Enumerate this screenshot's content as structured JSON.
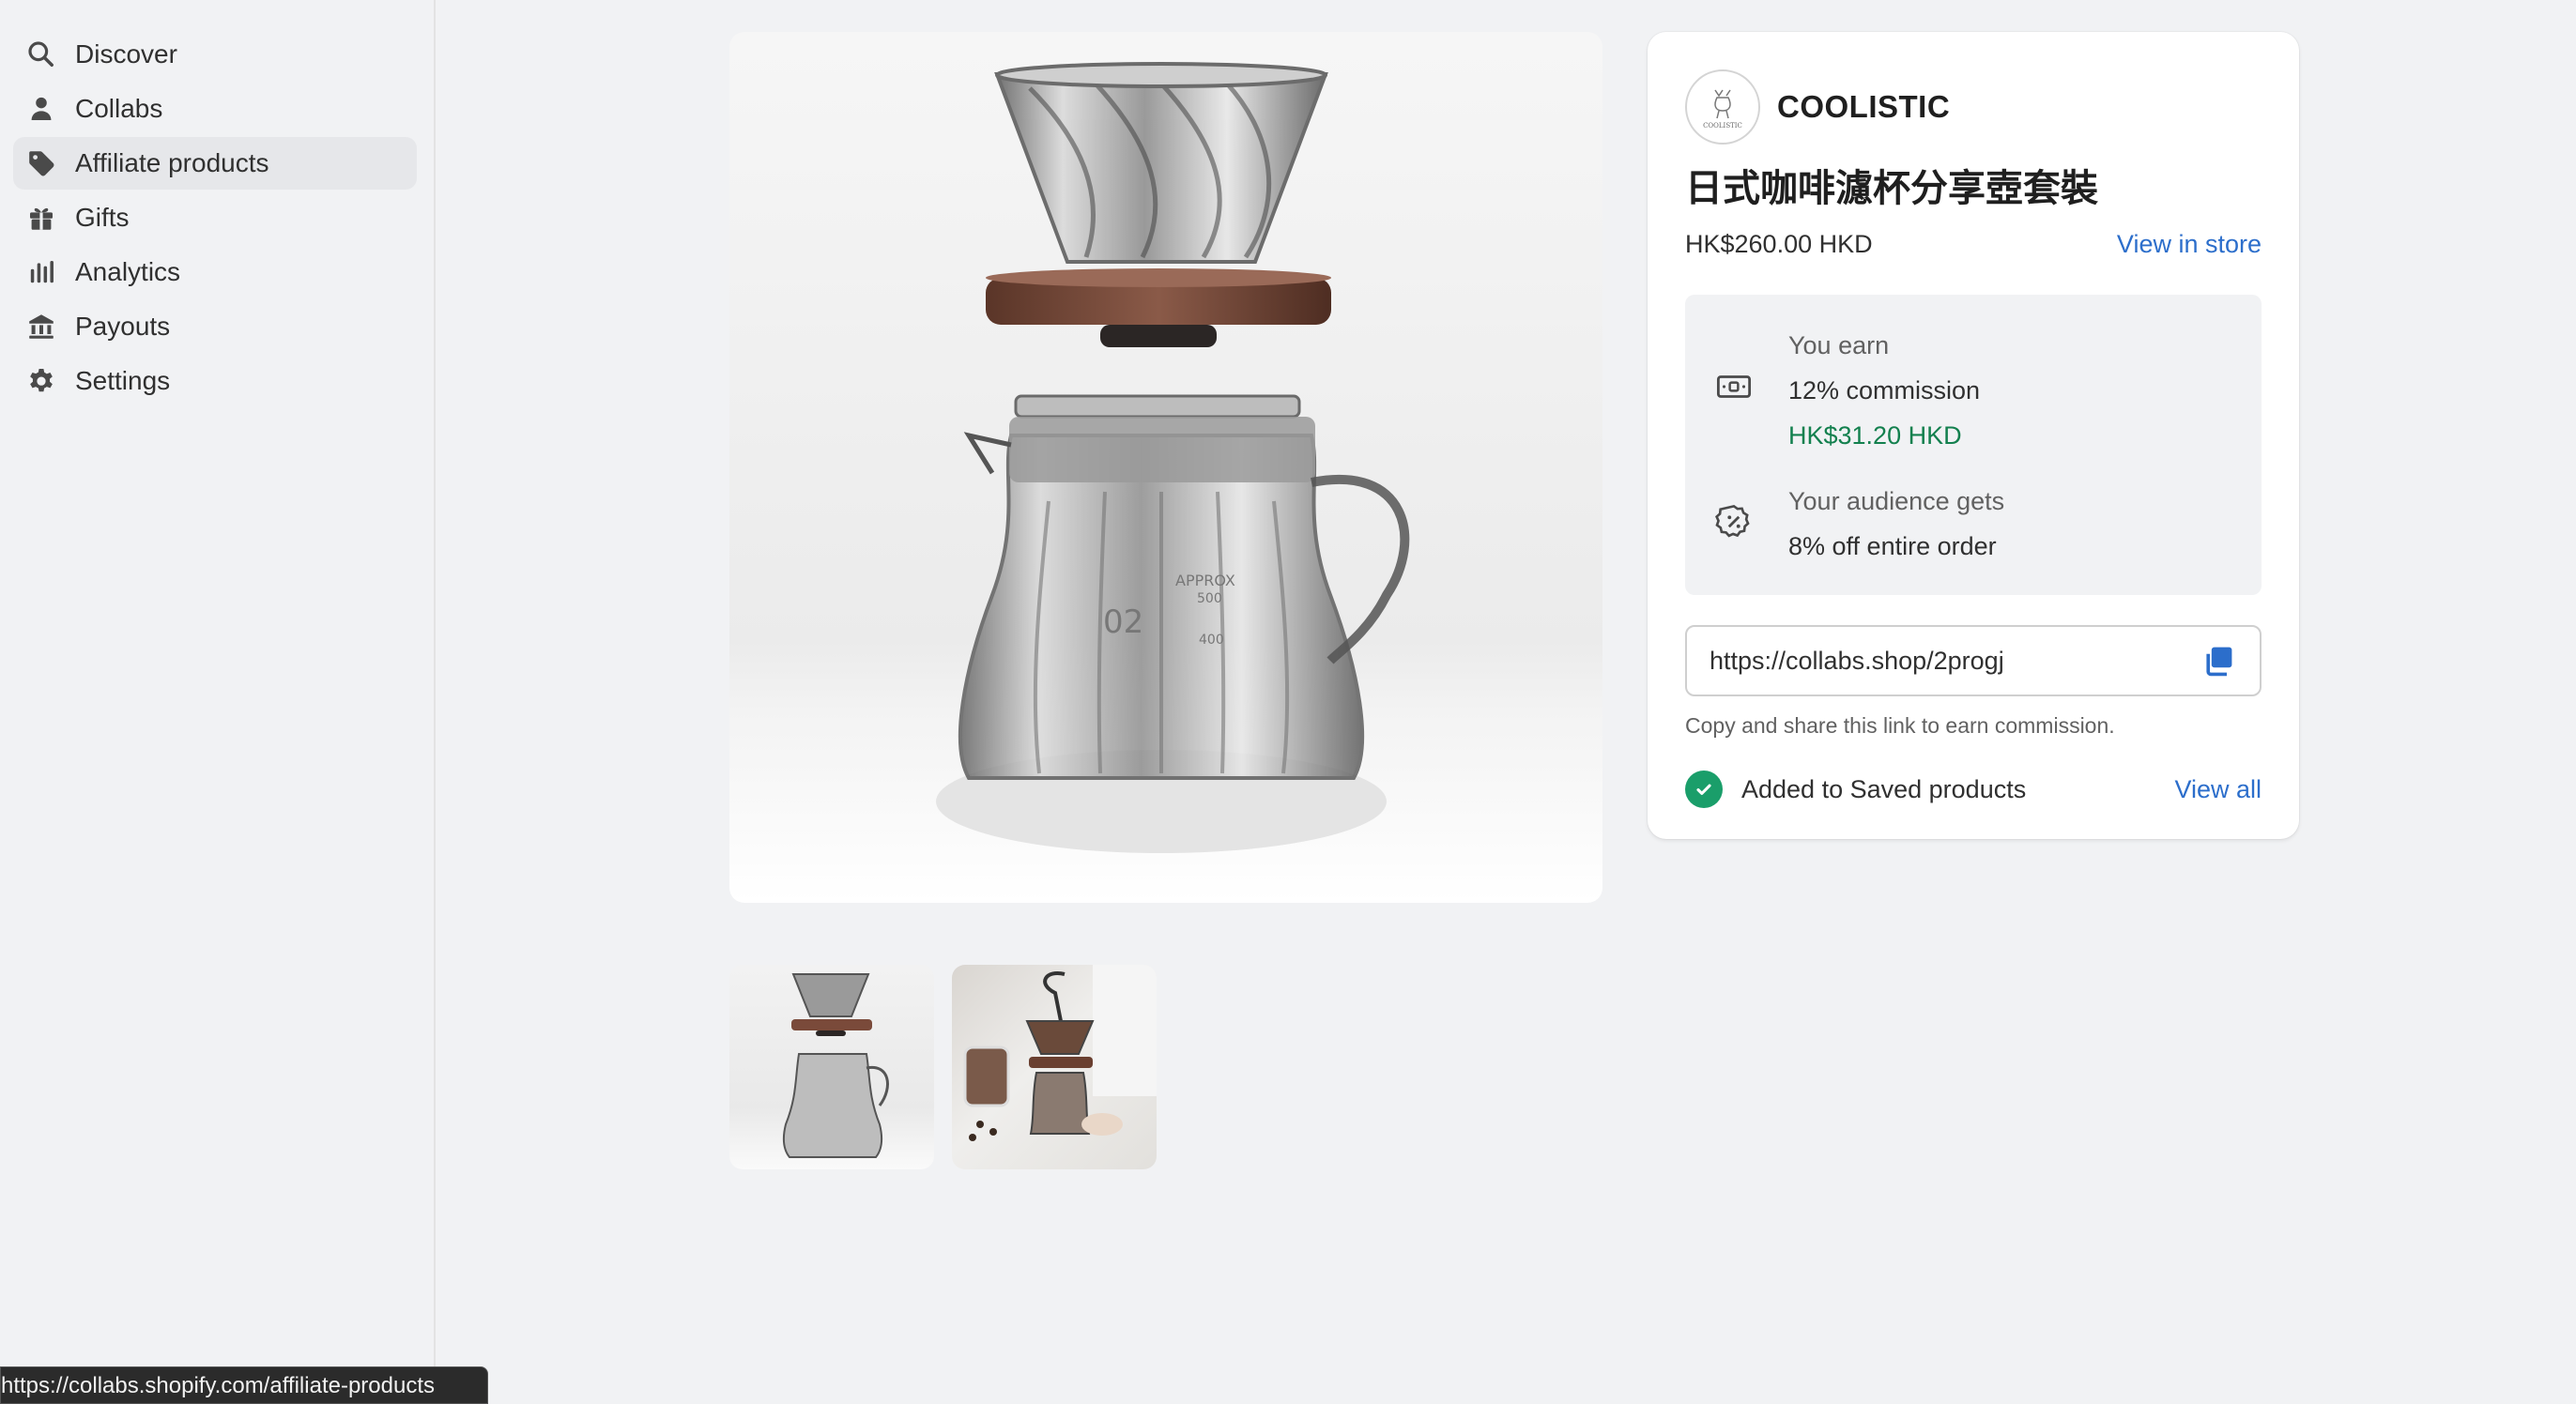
{
  "sidebar": {
    "items": [
      {
        "label": "Discover",
        "icon": "search-icon"
      },
      {
        "label": "Collabs",
        "icon": "person-icon"
      },
      {
        "label": "Affiliate products",
        "icon": "tag-icon",
        "active": true
      },
      {
        "label": "Gifts",
        "icon": "gift-icon"
      },
      {
        "label": "Analytics",
        "icon": "bar-chart-icon"
      },
      {
        "label": "Payouts",
        "icon": "bank-icon"
      },
      {
        "label": "Settings",
        "icon": "gear-icon"
      }
    ]
  },
  "product": {
    "brand": "COOLISTIC",
    "brand_logo_text": "COOLISTIC",
    "title": "日式咖啡濾杯分享壺套裝",
    "price": "HK$260.00 HKD",
    "view_in_store": "View in store",
    "main_image_marks": {
      "approx": "APPROX",
      "volume": "500",
      "number": "02",
      "level": "400"
    }
  },
  "earnings": {
    "you_earn_label": "You earn",
    "commission": "12% commission",
    "amount": "HK$31.20 HKD",
    "audience_label": "Your audience gets",
    "discount": "8% off entire order"
  },
  "share": {
    "link_value": "https://collabs.shop/2progj",
    "helper": "Copy and share this link to earn commission."
  },
  "saved": {
    "text": "Added to Saved products",
    "view_all": "View all"
  },
  "status_bar": {
    "url": "https://collabs.shopify.com/affiliate-products"
  },
  "colors": {
    "link": "#2c6ecb",
    "earn_green": "#13804e",
    "check_green": "#1a9e6a",
    "copy_icon": "#2c6ecb"
  }
}
